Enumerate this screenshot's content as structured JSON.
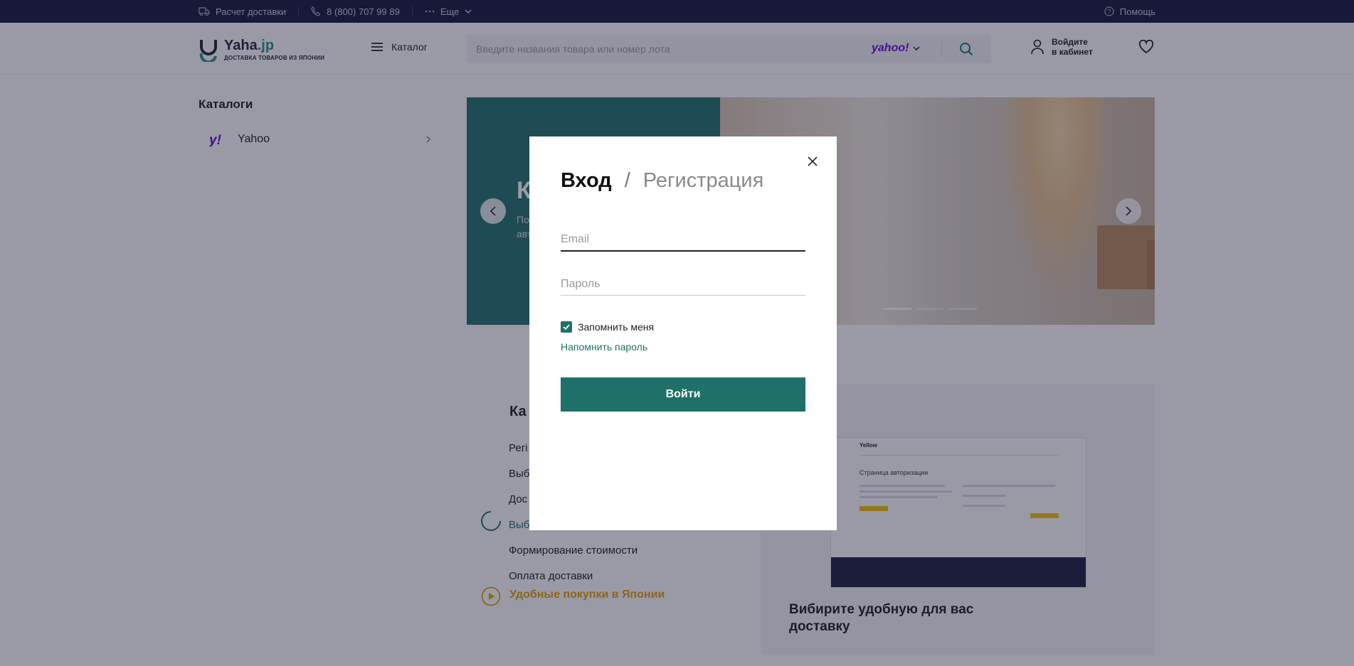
{
  "topbar": {
    "delivery_calc": "Расчет доставки",
    "phone": "8 (800) 707 99 89",
    "more": "Еще",
    "help": "Помощь"
  },
  "header": {
    "logo_name": "Yaha",
    "logo_tld": ".jp",
    "logo_tagline": "ДОСТАВКА ТОВАРОВ ИЗ ЯПОНИИ",
    "catalog": "Каталог",
    "search_placeholder": "Введите названия товара или номер лота",
    "search_source": "yahoo!",
    "login_line1": "Войдите",
    "login_line2": "в кабинет"
  },
  "sidebar": {
    "title": "Каталоги",
    "items": [
      {
        "label": "Yahoo",
        "icon": "yahoo-icon"
      }
    ]
  },
  "banner": {
    "heading_visible": "К",
    "text_visible_1": "По",
    "text_visible_2": "авт",
    "slides": 3,
    "active_slide": 1
  },
  "howto": {
    "title_visible": "Ка",
    "steps": [
      "Регі",
      "Выб",
      "Дос",
      "Выб",
      "Формирование стоимости",
      "Оплата доставки"
    ],
    "active_step": 3,
    "promo": "Удобные покупки в Японии"
  },
  "card": {
    "title": "Вибирите удобную для вас доставку",
    "shot_brand": "Yellow",
    "shot_heading": "Страница авторизации"
  },
  "modal": {
    "tab_login": "Вход",
    "tab_separator": "/",
    "tab_register": "Регистрация",
    "email_placeholder": "Email",
    "password_placeholder": "Пароль",
    "remember_label": "Запомнить меня",
    "remember_checked": true,
    "forgot_link": "Напомнить пароль",
    "submit_label": "Войти"
  },
  "colors": {
    "accent": "#1f7068",
    "topbar_bg": "#131536",
    "yahoo_purple": "#5f01d1",
    "promo_yellow": "#e0a100"
  }
}
